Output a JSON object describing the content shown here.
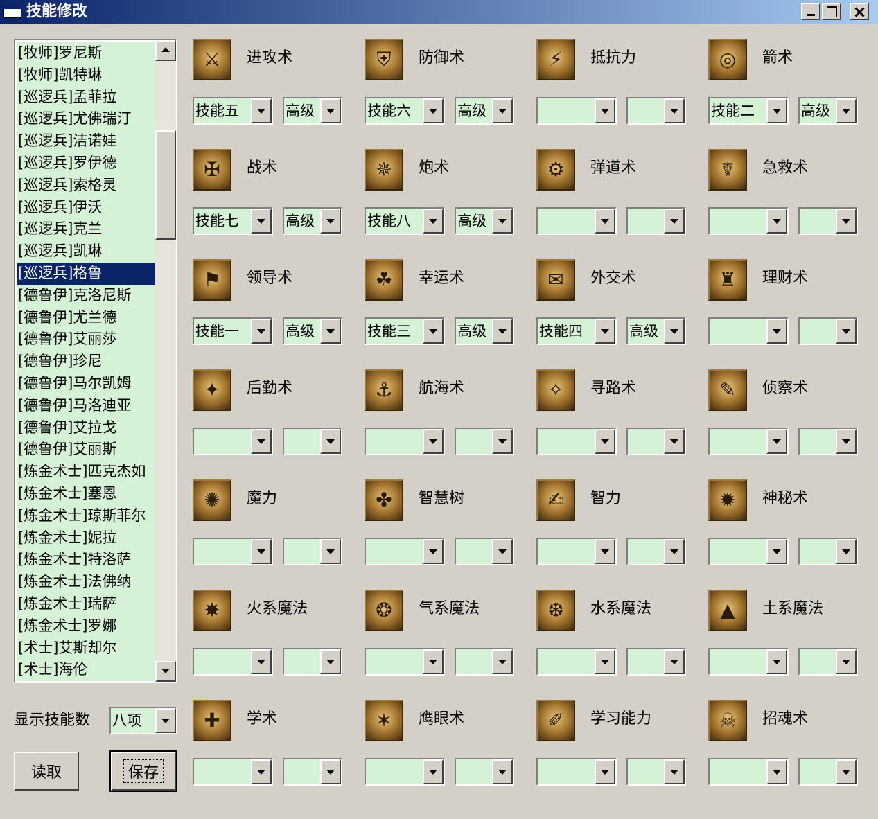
{
  "window": {
    "title": "技能修改"
  },
  "heroes": [
    "[牧师]罗尼斯",
    "[牧师]凯特琳",
    "[巡逻兵]孟菲拉",
    "[巡逻兵]尤佛瑞汀",
    "[巡逻兵]洁诺娃",
    "[巡逻兵]罗伊德",
    "[巡逻兵]索格灵",
    "[巡逻兵]伊沃",
    "[巡逻兵]克兰",
    "[巡逻兵]凯琳",
    "[巡逻兵]格鲁",
    "[德鲁伊]克洛尼斯",
    "[德鲁伊]尤兰德",
    "[德鲁伊]艾丽莎",
    "[德鲁伊]珍尼",
    "[德鲁伊]马尔凯姆",
    "[德鲁伊]马洛迪亚",
    "[德鲁伊]艾拉戈",
    "[德鲁伊]艾丽斯",
    "[炼金术士]匹克杰如",
    "[炼金术士]塞恩",
    "[炼金术士]琼斯菲尔",
    "[炼金术士]妮拉",
    "[炼金术士]特洛萨",
    "[炼金术士]法佛纳",
    "[炼金术士]瑞萨",
    "[炼金术士]罗娜",
    "[术士]艾斯却尔",
    "[术士]海伦"
  ],
  "selected_hero": "[巡逻兵]格鲁",
  "controls": {
    "count_label": "显示技能数",
    "count_value": "八项",
    "load_label": "读取",
    "save_label": "保存"
  },
  "skills": [
    {
      "name": "进攻术",
      "icon": "sword-icon",
      "glyph": "⚔",
      "slot": "技能五",
      "level": "高级"
    },
    {
      "name": "防御术",
      "icon": "shield-icon",
      "glyph": "⛨",
      "slot": "技能六",
      "level": "高级"
    },
    {
      "name": "抵抗力",
      "icon": "resistance-icon",
      "glyph": "⚡",
      "slot": "",
      "level": ""
    },
    {
      "name": "箭术",
      "icon": "archery-icon",
      "glyph": "◎",
      "slot": "技能二",
      "level": "高级"
    },
    {
      "name": "战术",
      "icon": "tactics-icon",
      "glyph": "✠",
      "slot": "技能七",
      "level": "高级"
    },
    {
      "name": "炮术",
      "icon": "artillery-icon",
      "glyph": "✵",
      "slot": "技能八",
      "level": "高级"
    },
    {
      "name": "弹道术",
      "icon": "ballistics-icon",
      "glyph": "⚙",
      "slot": "",
      "level": ""
    },
    {
      "name": "急救术",
      "icon": "first-aid-icon",
      "glyph": "☤",
      "slot": "",
      "level": ""
    },
    {
      "name": "领导术",
      "icon": "leadership-icon",
      "glyph": "⚑",
      "slot": "技能一",
      "level": "高级"
    },
    {
      "name": "幸运术",
      "icon": "luck-icon",
      "glyph": "☘",
      "slot": "技能三",
      "level": "高级"
    },
    {
      "name": "外交术",
      "icon": "diplomacy-icon",
      "glyph": "✉",
      "slot": "技能四",
      "level": "高级"
    },
    {
      "name": "理财术",
      "icon": "estates-icon",
      "glyph": "♜",
      "slot": "",
      "level": ""
    },
    {
      "name": "后勤术",
      "icon": "logistics-icon",
      "glyph": "✦",
      "slot": "",
      "level": ""
    },
    {
      "name": "航海术",
      "icon": "navigation-icon",
      "glyph": "⚓",
      "slot": "",
      "level": ""
    },
    {
      "name": "寻路术",
      "icon": "pathfinding-icon",
      "glyph": "✧",
      "slot": "",
      "level": ""
    },
    {
      "name": "侦察术",
      "icon": "scouting-icon",
      "glyph": "✎",
      "slot": "",
      "level": ""
    },
    {
      "name": "魔力",
      "icon": "sorcery-icon",
      "glyph": "✺",
      "slot": "",
      "level": ""
    },
    {
      "name": "智慧树",
      "icon": "wisdom-icon",
      "glyph": "✤",
      "slot": "",
      "level": ""
    },
    {
      "name": "智力",
      "icon": "intelligence-icon",
      "glyph": "✍",
      "slot": "",
      "level": ""
    },
    {
      "name": "神秘术",
      "icon": "mysticism-icon",
      "glyph": "✹",
      "slot": "",
      "level": ""
    },
    {
      "name": "火系魔法",
      "icon": "fire-magic-icon",
      "glyph": "✸",
      "slot": "",
      "level": ""
    },
    {
      "name": "气系魔法",
      "icon": "air-magic-icon",
      "glyph": "❂",
      "slot": "",
      "level": ""
    },
    {
      "name": "水系魔法",
      "icon": "water-magic-icon",
      "glyph": "❆",
      "slot": "",
      "level": ""
    },
    {
      "name": "土系魔法",
      "icon": "earth-magic-icon",
      "glyph": "▲",
      "slot": "",
      "level": ""
    },
    {
      "name": "学术",
      "icon": "scholar-icon",
      "glyph": "✚",
      "slot": "",
      "level": ""
    },
    {
      "name": "鹰眼术",
      "icon": "eagle-eye-icon",
      "glyph": "✶",
      "slot": "",
      "level": ""
    },
    {
      "name": "学习能力",
      "icon": "learning-icon",
      "glyph": "✐",
      "slot": "",
      "level": ""
    },
    {
      "name": "招魂术",
      "icon": "necromancy-icon",
      "glyph": "☠",
      "slot": "",
      "level": ""
    }
  ]
}
